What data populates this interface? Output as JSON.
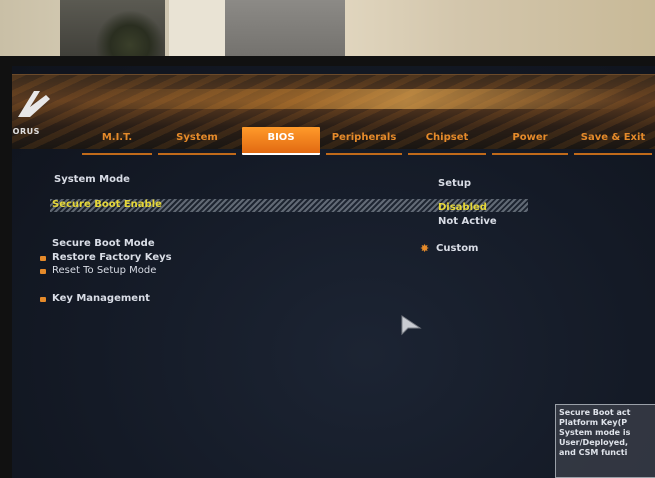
{
  "logo": {
    "brand_text": "RORUS"
  },
  "tabs": [
    {
      "label": "M.I.T.",
      "active": false
    },
    {
      "label": "System",
      "active": false
    },
    {
      "label": "BIOS",
      "active": true
    },
    {
      "label": "Peripherals",
      "active": false
    },
    {
      "label": "Chipset",
      "active": false
    },
    {
      "label": "Power",
      "active": false
    },
    {
      "label": "Save & Exit",
      "active": false
    }
  ],
  "settings": {
    "system_mode": {
      "label": "System Mode",
      "value": "Setup"
    },
    "secure_boot_enable": {
      "label": "Secure Boot Enable",
      "value": "Disabled",
      "status": "Not Active"
    },
    "secure_boot_mode": {
      "label": "Secure Boot Mode",
      "value": "Custom"
    },
    "restore_factory_keys": {
      "label": "Restore Factory Keys"
    },
    "reset_to_setup_mode": {
      "label": "Reset To Setup Mode"
    },
    "key_management": {
      "label": "Key Management"
    }
  },
  "help": {
    "lines": [
      "Secure Boot act",
      "Platform Key(P",
      "System mode is",
      "User/Deployed,",
      "and CSM functi"
    ]
  },
  "colors": {
    "accent": "#e58a2a",
    "highlight_text": "#e7d838",
    "text": "#d9dde6"
  }
}
